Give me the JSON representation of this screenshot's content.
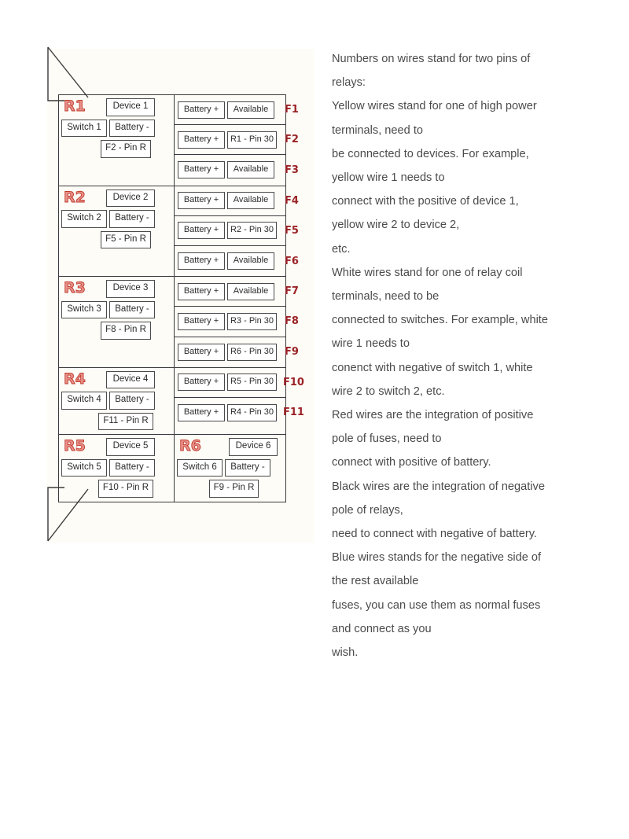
{
  "diagram": {
    "relays": [
      {
        "tag": "R1",
        "device": "Device 1",
        "switch": "Switch 1",
        "battery": "Battery -",
        "pin": "F2 - Pin R"
      },
      {
        "tag": "R2",
        "device": "Device 2",
        "switch": "Switch 2",
        "battery": "Battery -",
        "pin": "F5 - Pin R"
      },
      {
        "tag": "R3",
        "device": "Device 3",
        "switch": "Switch 3",
        "battery": "Battery -",
        "pin": "F8 - Pin R"
      },
      {
        "tag": "R4",
        "device": "Device 4",
        "switch": "Switch 4",
        "battery": "Battery -",
        "pin": "F11 - Pin R"
      },
      {
        "tag": "R5",
        "device": "Device 5",
        "switch": "Switch 5",
        "battery": "Battery -",
        "pin": "F10 - Pin R"
      },
      {
        "tag": "R6",
        "device": "Device 6",
        "switch": "Switch 6",
        "battery": "Battery -",
        "pin": "F9 - Pin R"
      }
    ],
    "fuses": [
      {
        "label": "F1",
        "left": "Battery +",
        "right": "Available"
      },
      {
        "label": "F2",
        "left": "Battery +",
        "right": "R1 - Pin 30"
      },
      {
        "label": "F3",
        "left": "Battery +",
        "right": "Available"
      },
      {
        "label": "F4",
        "left": "Battery +",
        "right": "Available"
      },
      {
        "label": "F5",
        "left": "Battery +",
        "right": "R2 - Pin 30"
      },
      {
        "label": "F6",
        "left": "Battery +",
        "right": "Available"
      },
      {
        "label": "F7",
        "left": "Battery +",
        "right": "Available"
      },
      {
        "label": "F8",
        "left": "Battery +",
        "right": "R3 - Pin 30"
      },
      {
        "label": "F9",
        "left": "Battery +",
        "right": "R6 - Pin 30"
      },
      {
        "label": "F10",
        "left": "Battery +",
        "right": "R5 - Pin 30"
      },
      {
        "label": "F11",
        "left": "Battery +",
        "right": "R4 - Pin 30"
      }
    ],
    "colors": {
      "relay_tag": "#e8918b",
      "relay_tag_outline": "#c0392b",
      "fuse_label": "#9b2226",
      "canvas": "#fdfcf7",
      "stroke": "#3b3b3b"
    }
  },
  "notes": {
    "lines": [
      "Numbers on wires stand for two pins of",
      "relays:",
      "Yellow wires stand for one of high power",
      "terminals, need to",
      "be connected to devices. For example,",
      "yellow wire 1 needs to",
      "connect with the positive of device 1,",
      "yellow wire 2 to device 2,",
      "etc.",
      "White wires stand for one of relay coil",
      "terminals, need to be",
      "connected to switches. For example, white",
      "wire 1 needs to",
      "conenct with negative of switch 1, white",
      "wire 2 to switch 2, etc.",
      "Red wires are the integration of positive",
      "pole of fuses, need to",
      "connect with positive of battery.",
      "Black wires are the integration of negative",
      "pole of relays,",
      "need to connect with negative of battery.",
      "Blue wires stands for the negative side of",
      "the rest available",
      "fuses, you can use them as normal fuses",
      "and connect as you",
      "wish."
    ]
  }
}
